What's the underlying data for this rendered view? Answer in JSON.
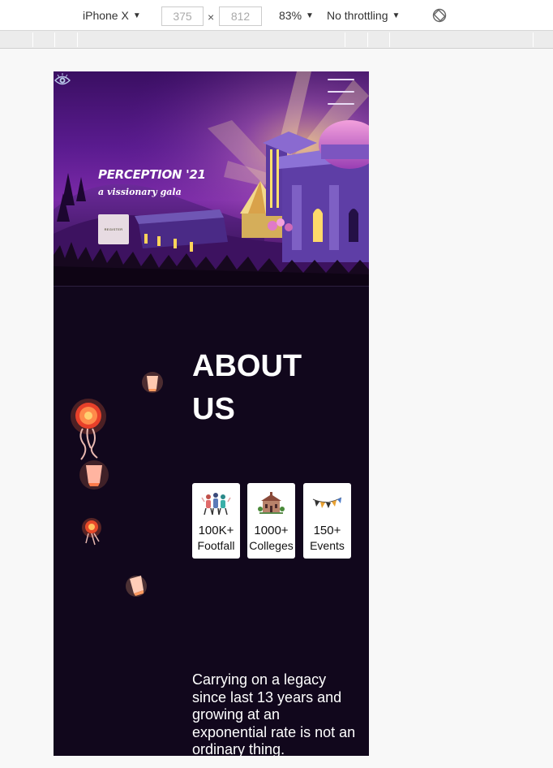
{
  "devtools": {
    "device": "iPhone X",
    "width": "375",
    "height": "812",
    "zoom": "83%",
    "throttling": "No throttling",
    "times": "×"
  },
  "hero": {
    "title": "PERCEPTION '21",
    "subtitle": "a vissionary gala",
    "button_label": "REGISTER"
  },
  "about": {
    "title_line1": "ABOUT",
    "title_line2": "US",
    "stats": [
      {
        "number": "100K+",
        "label": "Footfall",
        "icon": "people-icon"
      },
      {
        "number": "1000+",
        "label": "Colleges",
        "icon": "college-icon"
      },
      {
        "number": "150+",
        "label": "Events",
        "icon": "bunting-icon"
      }
    ],
    "description": "Carrying on a legacy since last 13 years and growing at an exponential rate is not an ordinary thing."
  }
}
